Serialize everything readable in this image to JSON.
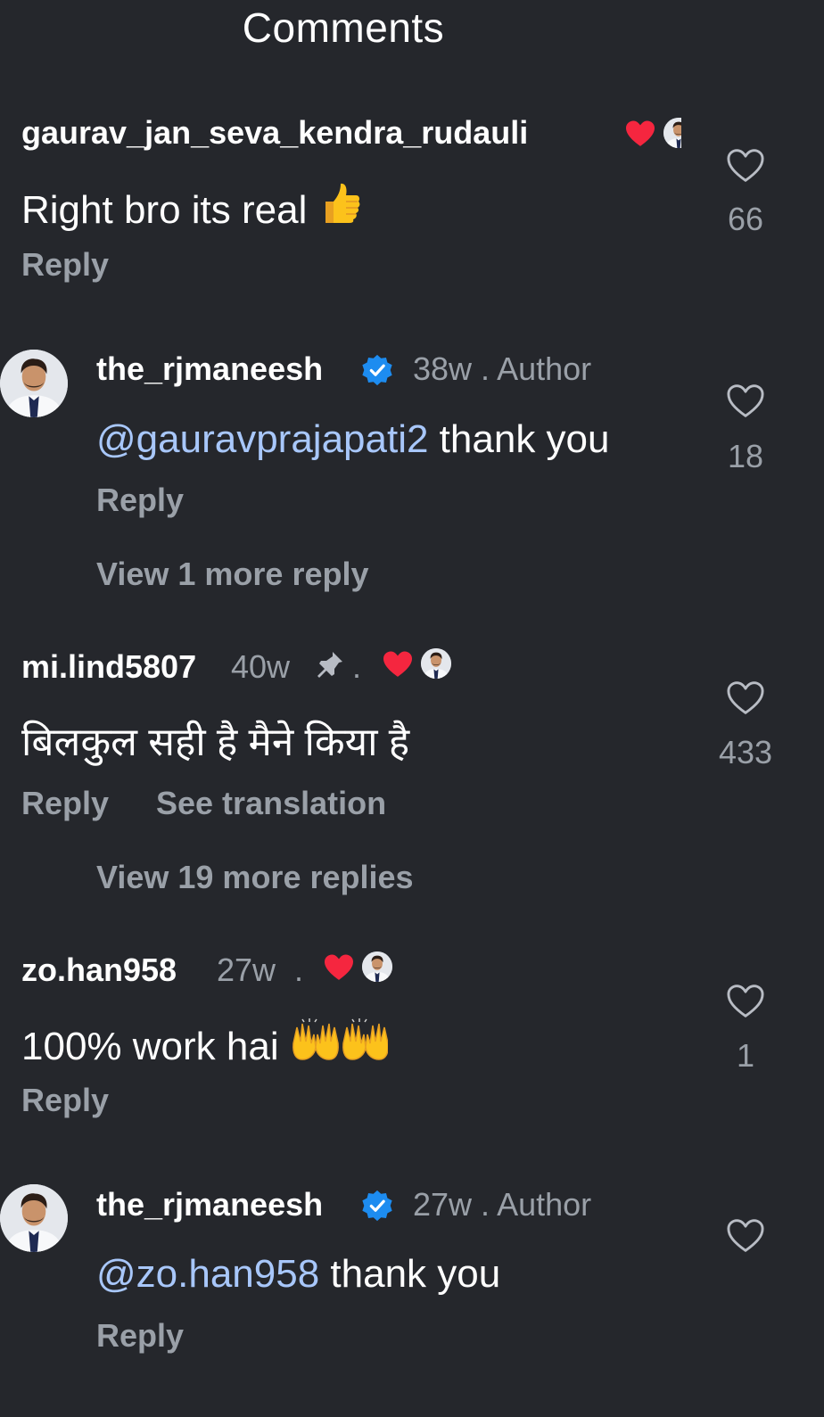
{
  "header": {
    "title": "Comments"
  },
  "comments": [
    {
      "username": "gaurav_jan_seva_kendra_rudauli",
      "time": "",
      "text": "Right bro its real",
      "emoji": "thumbs-up",
      "reply_label": "Reply",
      "likes": "66",
      "creator_liked": true
    },
    {
      "username": "the_rjmaneesh",
      "verified": true,
      "time": "38w",
      "author_label": "Author",
      "mention": "@gauravprajapati2",
      "text": " thank you",
      "reply_label": "Reply",
      "likes": "18",
      "view_more": "View 1 more reply"
    },
    {
      "username": "mi.lind5807",
      "time": "40w",
      "pinned": true,
      "text": "बिलकुल सही है मैने किया है",
      "reply_label": "Reply",
      "translate_label": "See translation",
      "likes": "433",
      "creator_liked": true,
      "view_more": "View 19 more replies"
    },
    {
      "username": "zo.han958",
      "time": "27w",
      "text": "100% work hai",
      "emoji": "raising-hands x2",
      "reply_label": "Reply",
      "likes": "1",
      "creator_liked": true
    },
    {
      "username": "the_rjmaneesh",
      "verified": true,
      "time": "27w",
      "author_label": "Author",
      "mention": "@zo.han958",
      "text": " thank you",
      "reply_label": "Reply",
      "likes": ""
    }
  ],
  "colors": {
    "background": "#25272c",
    "mention": "#a8c7fa",
    "muted": "#9aa0a8",
    "verified": "#1d8cf0",
    "like_red": "#f5263f"
  }
}
